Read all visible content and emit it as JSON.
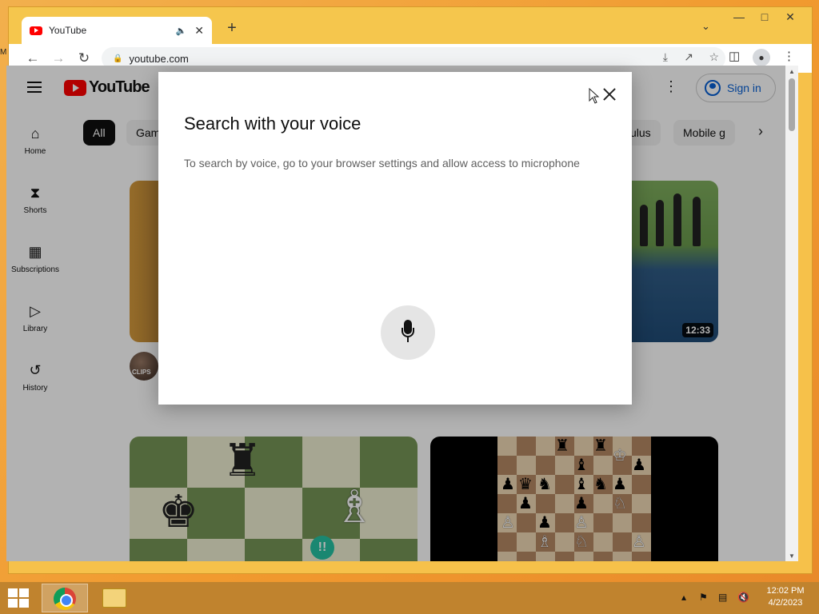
{
  "browser": {
    "tab_title": "YouTube",
    "url": "youtube.com",
    "new_tab_symbol": "+",
    "audio_symbol": "🔈",
    "close_symbol": "✕"
  },
  "youtube": {
    "logo_text": "YouTube",
    "sign_in": "Sign in",
    "guide": [
      {
        "label": "Home",
        "icon": "home-icon"
      },
      {
        "label": "Shorts",
        "icon": "shorts-icon"
      },
      {
        "label": "Subscriptions",
        "icon": "subscriptions-icon"
      },
      {
        "label": "Library",
        "icon": "library-icon"
      },
      {
        "label": "History",
        "icon": "history-icon"
      }
    ],
    "chips": [
      "All",
      "Gam",
      "ulus",
      "Mobile g"
    ],
    "video": {
      "duration": "12:33",
      "channel_badge": "CLIPS"
    }
  },
  "dialog": {
    "title": "Search with your voice",
    "message": "To search by voice, go to your browser settings and allow access to microphone"
  },
  "taskbar": {
    "time": "12:02 PM",
    "date": "4/2/2023"
  },
  "colors": {
    "youtube_red": "#ff0000",
    "link_blue": "#065fd4",
    "taskbar": "#c0832e"
  }
}
